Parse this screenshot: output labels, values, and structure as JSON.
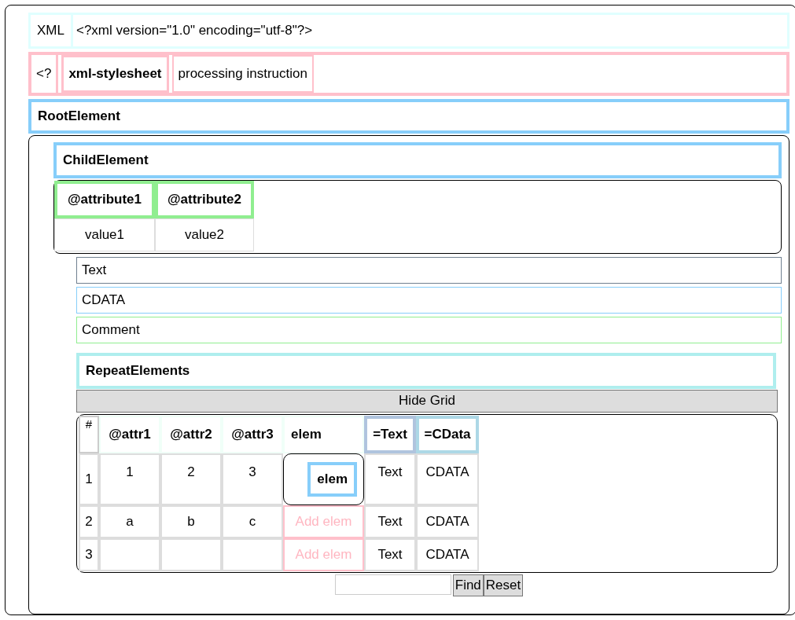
{
  "declaration": {
    "label": "XML",
    "text": "<?xml version=\"1.0\" encoding=\"utf-8\"?>"
  },
  "processing_instruction": {
    "marker": "<?",
    "target": "xml-stylesheet",
    "data": "processing instruction"
  },
  "root": {
    "name": "RootElement"
  },
  "child": {
    "name": "ChildElement",
    "attributes": [
      {
        "name": "@attribute1",
        "value": "value1"
      },
      {
        "name": "@attribute2",
        "value": "value2"
      }
    ]
  },
  "nodes": [
    {
      "kind": "text",
      "text": "Text"
    },
    {
      "kind": "cdata",
      "text": "CDATA"
    },
    {
      "kind": "comment",
      "text": "Comment"
    }
  ],
  "repeat": {
    "name": "RepeatElements",
    "toggle_button": "Hide Grid",
    "columns": [
      {
        "kind": "index",
        "label": "#"
      },
      {
        "kind": "attr",
        "label": "@attr1"
      },
      {
        "kind": "attr",
        "label": "@attr2"
      },
      {
        "kind": "attr",
        "label": "@attr3"
      },
      {
        "kind": "elem",
        "label": "elem"
      },
      {
        "kind": "text",
        "label": "=Text"
      },
      {
        "kind": "cdata",
        "label": "=CData"
      }
    ],
    "rows": [
      {
        "cells": [
          {
            "kind": "index",
            "text": "1"
          },
          {
            "kind": "value",
            "text": "1"
          },
          {
            "kind": "value",
            "text": "2"
          },
          {
            "kind": "value",
            "text": "3"
          },
          {
            "kind": "element",
            "text": "elem"
          },
          {
            "kind": "value",
            "text": "Text"
          },
          {
            "kind": "value",
            "text": "CDATA"
          }
        ]
      },
      {
        "cells": [
          {
            "kind": "index",
            "text": "2"
          },
          {
            "kind": "value",
            "text": "a"
          },
          {
            "kind": "value",
            "text": "b"
          },
          {
            "kind": "value",
            "text": "c"
          },
          {
            "kind": "add",
            "text": "Add elem"
          },
          {
            "kind": "value",
            "text": "Text"
          },
          {
            "kind": "value",
            "text": "CDATA"
          }
        ]
      },
      {
        "cells": [
          {
            "kind": "index",
            "text": "3"
          },
          {
            "kind": "empty"
          },
          {
            "kind": "empty"
          },
          {
            "kind": "empty"
          },
          {
            "kind": "add",
            "text": "Add elem"
          },
          {
            "kind": "value",
            "text": "Text"
          },
          {
            "kind": "value",
            "text": "CDATA"
          }
        ]
      }
    ],
    "find": {
      "button": "Find",
      "reset": "Reset"
    }
  }
}
